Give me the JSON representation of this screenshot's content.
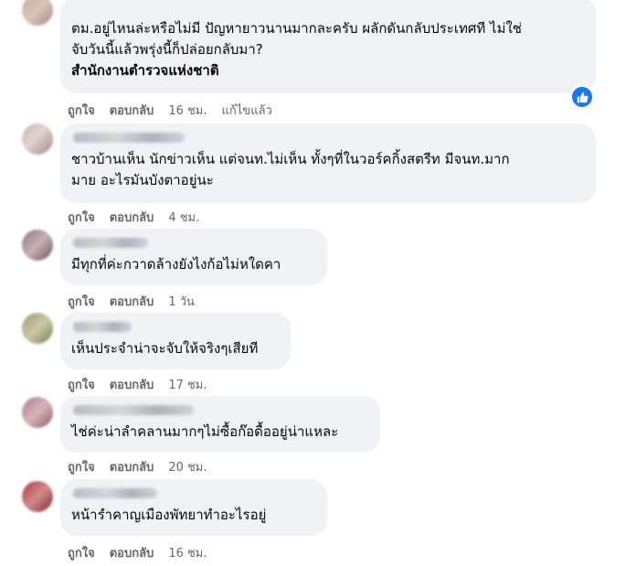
{
  "actions": {
    "like": "ถูกใจ",
    "reply": "ตอบกลับ",
    "edited": "แก้ไขแล้ว"
  },
  "colors": {
    "bubble": "#f0f2f5",
    "meta_text": "#65676b",
    "like_badge": "#1877f2"
  },
  "comments": [
    {
      "text": "ตม.อยู่ไหนล่ะหรือไม่มี ปัญหายาวนานมากละครับ ผลักดันกลับประเทศที ไม่ใช่\nจับวันนี้แล้วพรุ่งนี้ก็ปล่อยกลับมา?",
      "page_tag": "สำนักงานตำรวจแห่งชาติ",
      "time": "16 ชม.",
      "reaction_icon": "like-icon"
    },
    {
      "text": "ชาวบ้านเห็น นักข่าวเห็น แต่จนท.ไม่เห็น ทั้งๆที่ในวอร์คกิ้งสตรีท มีจนท.มาก\nมาย อะไรมันบังตาอยู่นะ",
      "time": "4 ชม."
    },
    {
      "text": "มีทุกที่ค่ะกวาดล้างยังไงก้อไม่หใดคา",
      "time": "1 วัน"
    },
    {
      "text": "เห็นประจำน่าจะจับให้จริงๆเสียที",
      "time": "17 ชม."
    },
    {
      "text": "ไช่ค่ะน่าลำคลานมากๆไม่ซื้อก๊อดื้ออยู่น่าแหละ",
      "time": "20 ชม."
    },
    {
      "text": "หน้ารำคาญเมืองพัทยาทำอะไรอยู่",
      "time": "16 ชม."
    }
  ]
}
